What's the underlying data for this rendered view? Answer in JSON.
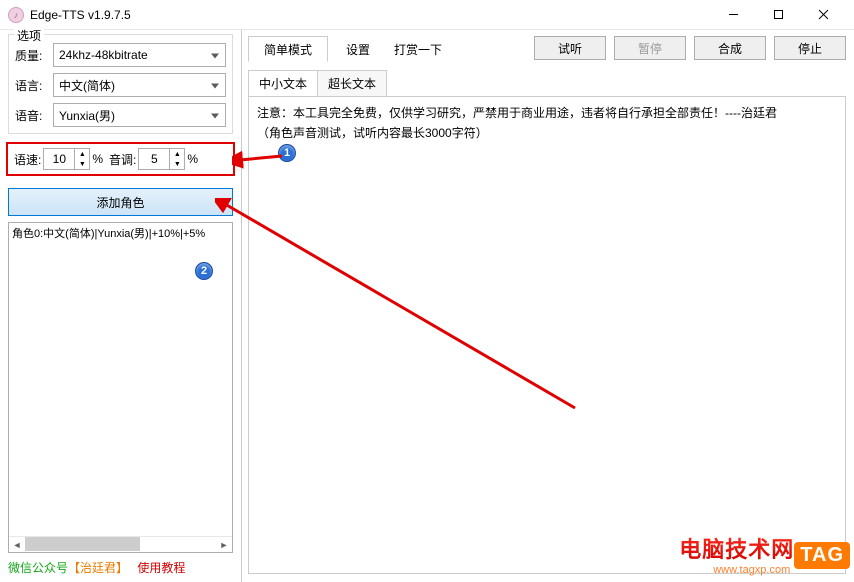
{
  "titlebar": {
    "title": "Edge-TTS v1.9.7.5"
  },
  "options": {
    "group_title": "选项",
    "quality_label": "质量:",
    "quality_value": "24khz-48kbitrate",
    "language_label": "语言:",
    "language_value": "中文(简体)",
    "voice_label": "语音:",
    "voice_value": "Yunxia(男)"
  },
  "speed": {
    "speed_label": "语速:",
    "speed_value": "10",
    "speed_unit": "%",
    "pitch_label": "音调:",
    "pitch_value": "5",
    "pitch_unit": "%"
  },
  "add_role_label": "添加角色",
  "role_list": {
    "items": [
      "角色0:中文(简体)|Yunxia(男)|+10%|+5%"
    ]
  },
  "footer": {
    "wechat": "微信公众号",
    "author": "【治廷君】",
    "tutorial": "使用教程"
  },
  "mode_tabs": {
    "simple": "简单模式",
    "settings": "设置",
    "donate": "打赏一下"
  },
  "actions": {
    "preview": "试听",
    "pause": "暂停",
    "synthesize": "合成",
    "stop": "停止"
  },
  "text_tabs": {
    "small": "中小文本",
    "long": "超长文本"
  },
  "text_content": {
    "line1": "注意：本工具完全免费，仅供学习研究，严禁用于商业用途，违者将自行承担全部责任！----治廷君",
    "line2": "（角色声音测试，试听内容最长3000字符）"
  },
  "callouts": {
    "one": "1",
    "two": "2"
  },
  "watermark": {
    "text": "电脑技术网",
    "sub": "www.tagxp.com",
    "badge": "TAG"
  }
}
